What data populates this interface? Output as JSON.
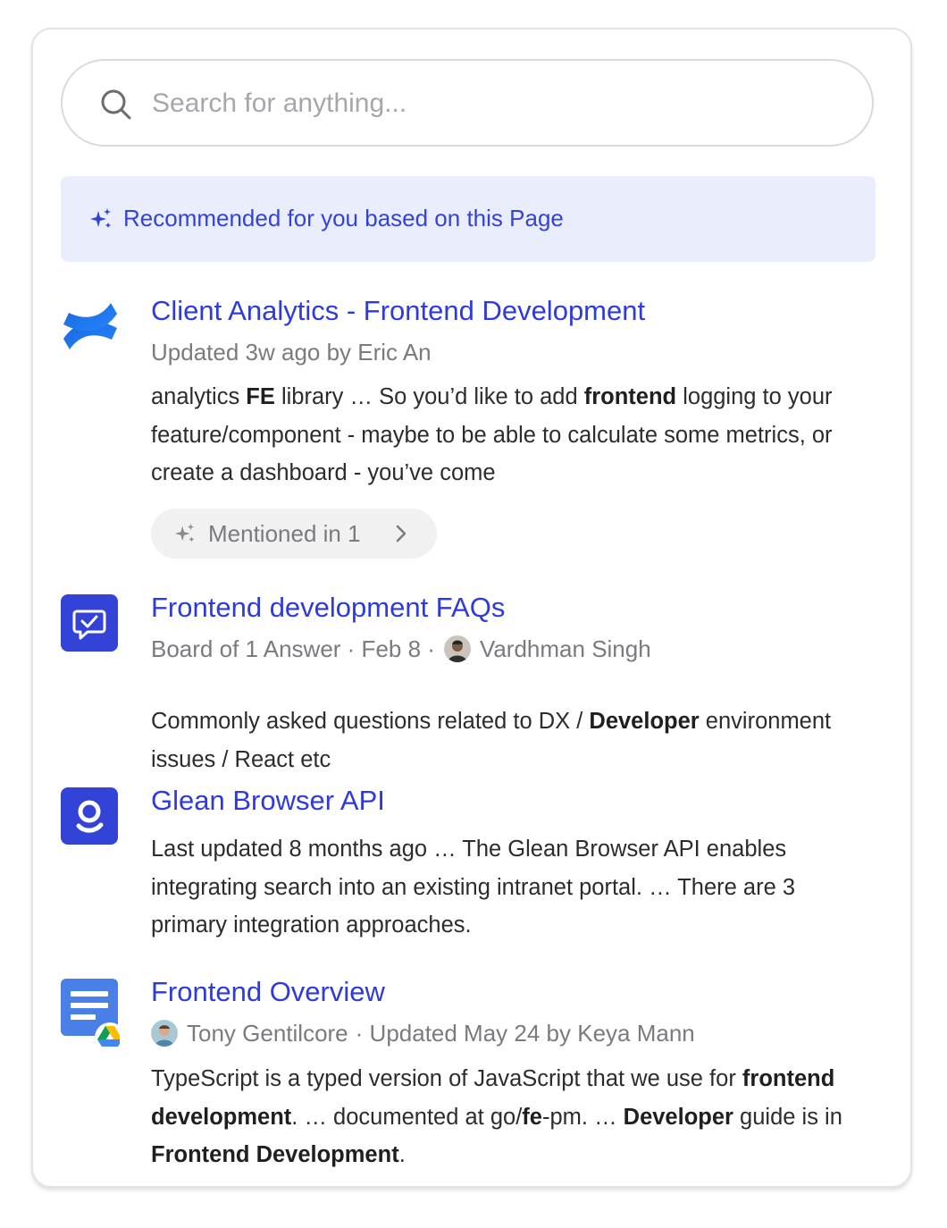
{
  "search": {
    "placeholder": "Search for anything..."
  },
  "recommendation_banner": {
    "label": "Recommended for you based on this Page",
    "icon": "sparkle-icon"
  },
  "results": [
    {
      "icon": "confluence-logo-icon",
      "title": "Client Analytics - Frontend Development",
      "meta": "Updated 3w ago by Eric An",
      "snippet_html_parts": [
        [
          "analytics ",
          false
        ],
        [
          "FE",
          true
        ],
        [
          " library … So you’d like to add ",
          false
        ],
        [
          "frontend",
          true
        ],
        [
          " logging to your feature/component - maybe to be able to calculate some metrics, or create a dashboard - you’ve come",
          false
        ]
      ],
      "mention_chip": "Mentioned in 1"
    },
    {
      "icon": "answer-board-icon",
      "title": "Frontend development FAQs",
      "meta_prefix": "Board of 1 Answer · Feb 8 ·",
      "meta_person": "Vardhman Singh",
      "snippet_html_parts": [
        [
          "Commonly asked questions related to DX / ",
          false
        ],
        [
          "Developer",
          true
        ],
        [
          " environment issues / React etc",
          false
        ]
      ]
    },
    {
      "icon": "glean-logo-icon",
      "title": "Glean Browser API",
      "snippet_html_parts": [
        [
          "Last updated 8 months ago … The Glean Browser API enables integrating search into an existing intranet portal. … There are 3 primary integration approaches.",
          false
        ]
      ]
    },
    {
      "icon": "google-doc-icon",
      "badge_icon": "google-drive-icon",
      "title": "Frontend Overview",
      "meta_person": "Tony Gentilcore",
      "meta_suffix": "· Updated May 24 by Keya Mann",
      "snippet_html_parts": [
        [
          "TypeScript is a typed version of JavaScript that we use for ",
          false
        ],
        [
          "frontend development",
          true
        ],
        [
          ". … documented at go/",
          false
        ],
        [
          "fe",
          true
        ],
        [
          "-pm. … ",
          false
        ],
        [
          "Developer",
          true
        ],
        [
          " guide is in ",
          false
        ],
        [
          "Frontend Development",
          true
        ],
        [
          ".",
          false
        ]
      ]
    }
  ],
  "colors": {
    "accent": "#2d3ade",
    "banner_bg": "#eaedfb",
    "meta_text": "#7a7a7f"
  }
}
